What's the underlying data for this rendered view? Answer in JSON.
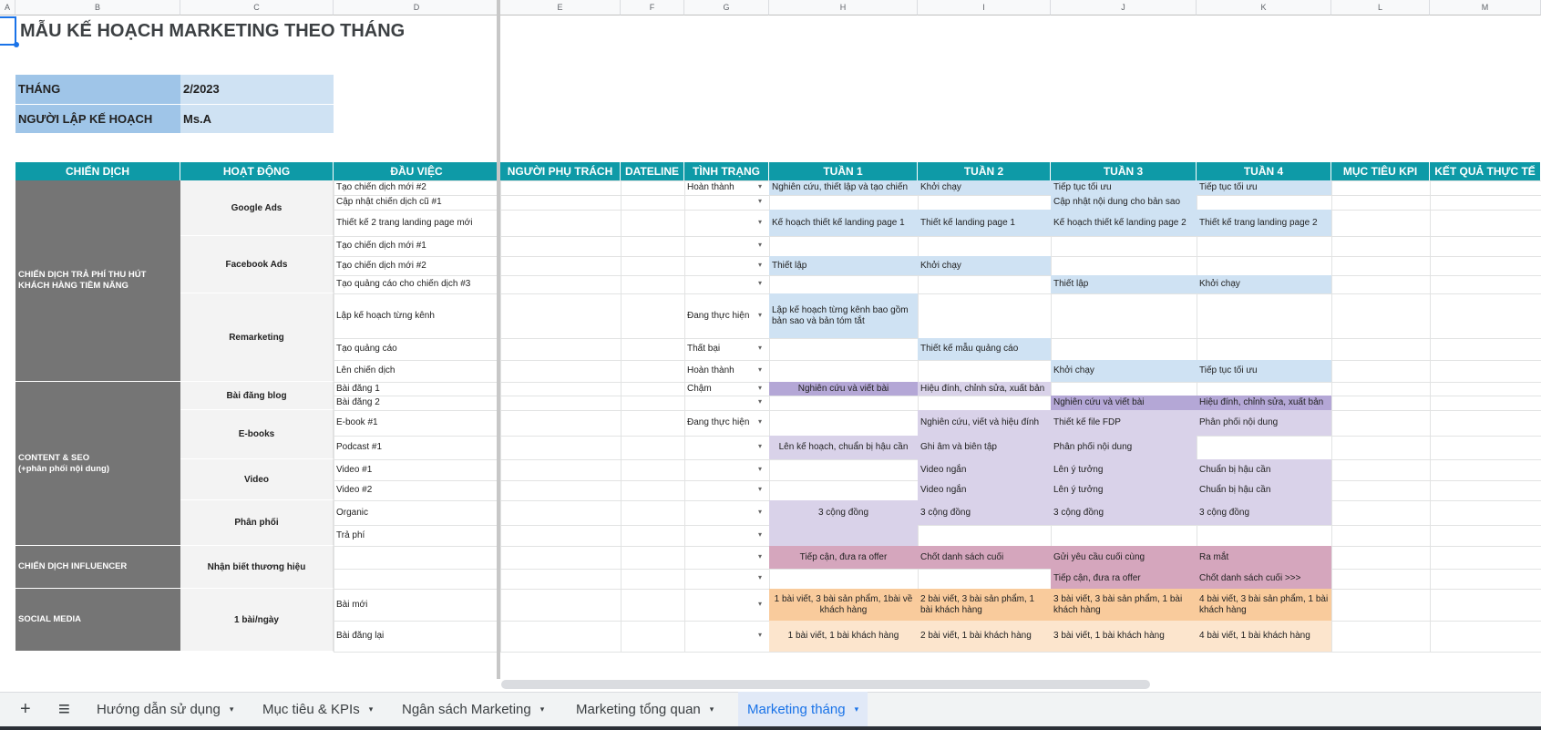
{
  "columns": [
    "A",
    "B",
    "C",
    "D",
    "E",
    "F",
    "G",
    "H",
    "I",
    "J",
    "K",
    "L",
    "M"
  ],
  "title": "MẪU KẾ HOẠCH MARKETING THEO THÁNG",
  "info": {
    "month_label": "THÁNG",
    "month_value": "2/2023",
    "planner_label": "NGƯỜI LẬP KẾ HOẠCH",
    "planner_value": "Ms.A"
  },
  "headers": [
    "CHIẾN DỊCH",
    "HOẠT ĐỘNG",
    "ĐẦU VIỆC",
    "NGƯỜI PHỤ TRÁCH",
    "DATELINE",
    "TÌNH TRẠNG",
    "TUẦN 1",
    "TUẦN 2",
    "TUẦN 3",
    "TUẦN 4",
    "MỤC TIÊU KPI",
    "KẾT QUẢ THỰC TẾ"
  ],
  "campaigns": [
    {
      "name": "CHIẾN DỊCH TRẢ PHÍ THU HÚT KHÁCH HÀNG TIỀM NĂNG"
    },
    {
      "name": "CONTENT & SEO\n(+phân phối nội dung)"
    },
    {
      "name": "CHIẾN DỊCH INFLUENCER"
    },
    {
      "name": "SOCIAL MEDIA"
    }
  ],
  "activities": [
    "Google Ads",
    "Facebook Ads",
    "Remarketing",
    "Bài đăng blog",
    "E-books",
    "Video",
    "Phân phối",
    "Nhận biết thương hiệu",
    "1 bài/ngày"
  ],
  "rows": [
    {
      "task": "Tạo chiến dịch mới #2",
      "status": "Hoàn thành",
      "w1": "Nghiên cứu, thiết lập và tạo chiến",
      "w2": "Khởi chạy",
      "w3": "Tiếp tục tối ưu",
      "w4": "Tiếp tục tối ưu"
    },
    {
      "task": "Cập nhật chiến dịch cũ #1",
      "status": "",
      "w1": "",
      "w2": "",
      "w3": "Cập nhật nội dung cho bản sao",
      "w4": ""
    },
    {
      "task": "Thiết kế 2 trang landing page mới",
      "status": "",
      "w1": "Kế hoạch thiết kế landing page 1",
      "w2": "Thiết kế landing page 1",
      "w3": "Kế hoạch thiết kế landing page 2",
      "w4": "Thiết kế trang landing page 2"
    },
    {
      "task": "Tạo chiến dịch mới #1",
      "status": "",
      "w1": "",
      "w2": "",
      "w3": "",
      "w4": ""
    },
    {
      "task": "Tạo chiến dịch mới #2",
      "status": "",
      "w1": "Thiết lập",
      "w2": "Khởi chạy",
      "w3": "",
      "w4": ""
    },
    {
      "task": "Tạo quảng cáo cho chiến dịch #3",
      "status": "",
      "w1": "",
      "w2": "",
      "w3": "Thiết lập",
      "w4": "Khởi chạy"
    },
    {
      "task": "Lập kế hoạch từng kênh",
      "status": "Đang thực hiện",
      "w1": "Lập kế hoạch từng kênh bao gồm bản sao và bản tóm tắt",
      "w2": "",
      "w3": "",
      "w4": ""
    },
    {
      "task": "Tạo quảng cáo",
      "status": "Thất bại",
      "w1": "",
      "w2": "Thiết kế mẫu quảng cáo",
      "w3": "",
      "w4": ""
    },
    {
      "task": "Lên chiến dịch",
      "status": "Hoàn thành",
      "w1": "",
      "w2": "",
      "w3": "Khởi chạy",
      "w4": "Tiếp tục tối ưu"
    },
    {
      "task": "Bài đăng 1",
      "status": "Chậm",
      "w1": "Nghiên cứu và viết bài",
      "w2": "Hiệu đính, chỉnh sửa, xuất bản",
      "w3": "",
      "w4": ""
    },
    {
      "task": "Bài đăng 2",
      "status": "",
      "w1": "",
      "w2": "",
      "w3": "Nghiên cứu và viết bài",
      "w4": "Hiệu đính, chỉnh sửa, xuất bản"
    },
    {
      "task": "E-book #1",
      "status": "Đang thực hiện",
      "w1": "",
      "w2": "Nghiên cứu, viết và hiệu đính",
      "w3": "Thiết kế file FDP",
      "w4": "Phân phối nội dung"
    },
    {
      "task": "Podcast #1",
      "status": "",
      "w1": "Lên kế hoạch, chuẩn bị  hậu cần",
      "w2": "Ghi âm và biên tập",
      "w3": "Phân phối nội dung",
      "w4": ""
    },
    {
      "task": "Video #1",
      "status": "",
      "w1": "",
      "w2": "Video ngắn",
      "w3": "Lên ý tưởng",
      "w4": "Chuẩn bị hậu cần"
    },
    {
      "task": "Video #2",
      "status": "",
      "w1": "",
      "w2": "Video ngắn",
      "w3": "Lên ý tưởng",
      "w4": "Chuẩn bị hậu cần"
    },
    {
      "task": "Organic",
      "status": "",
      "w1": "3 cộng đồng",
      "w2": "3 cộng đồng",
      "w3": "3 cộng đồng",
      "w4": "3 cộng đồng"
    },
    {
      "task": "Trả phí",
      "status": "",
      "w1": "",
      "w2": "",
      "w3": "",
      "w4": ""
    },
    {
      "task": "",
      "status": "",
      "w1": "Tiếp cận, đưa ra offer",
      "w2": "Chốt danh sách cuối",
      "w3": "Gửi yêu cầu cuối cùng",
      "w4": "Ra mắt"
    },
    {
      "task": "",
      "status": "",
      "w1": "",
      "w2": "",
      "w3": "Tiếp cận, đưa ra offer",
      "w4": "Chốt danh sách cuối >>>"
    },
    {
      "task": "Bài mới",
      "status": "",
      "w1": "1 bài viết, 3 bài sản phẩm, 1bài về khách hàng",
      "w2": "2 bài viết, 3 bài sản phẩm, 1 bài khách hàng",
      "w3": "3 bài viết, 3 bài sản phẩm, 1 bài khách hàng",
      "w4": "4 bài viết, 3 bài sản phẩm, 1 bài khách hàng"
    },
    {
      "task": "Bài đăng lại",
      "status": "",
      "w1": "1 bài viết, 1 bài khách hàng",
      "w2": "2 bài viết, 1 bài khách hàng",
      "w3": "3 bài viết, 1 bài khách hàng",
      "w4": "4 bài viết, 1 bài khách hàng"
    }
  ],
  "colors": {
    "header": "#0e9aa7",
    "blue": "#cfe2f3",
    "purple": "#d9d2e9",
    "purple_dark": "#b4a7d6",
    "pink": "#d5a6bd",
    "orange": "#f9cb9c",
    "orange_light": "#fce5cd",
    "grey": "#757575"
  },
  "tabs": {
    "add_icon": "+",
    "list_icon": "≡",
    "items": [
      "Hướng dẫn sử dụng",
      "Mục tiêu & KPIs",
      "Ngân sách Marketing",
      "Marketing tổng quan",
      "Marketing tháng"
    ],
    "active": "Marketing tháng",
    "dropdown_icon": "▾"
  }
}
